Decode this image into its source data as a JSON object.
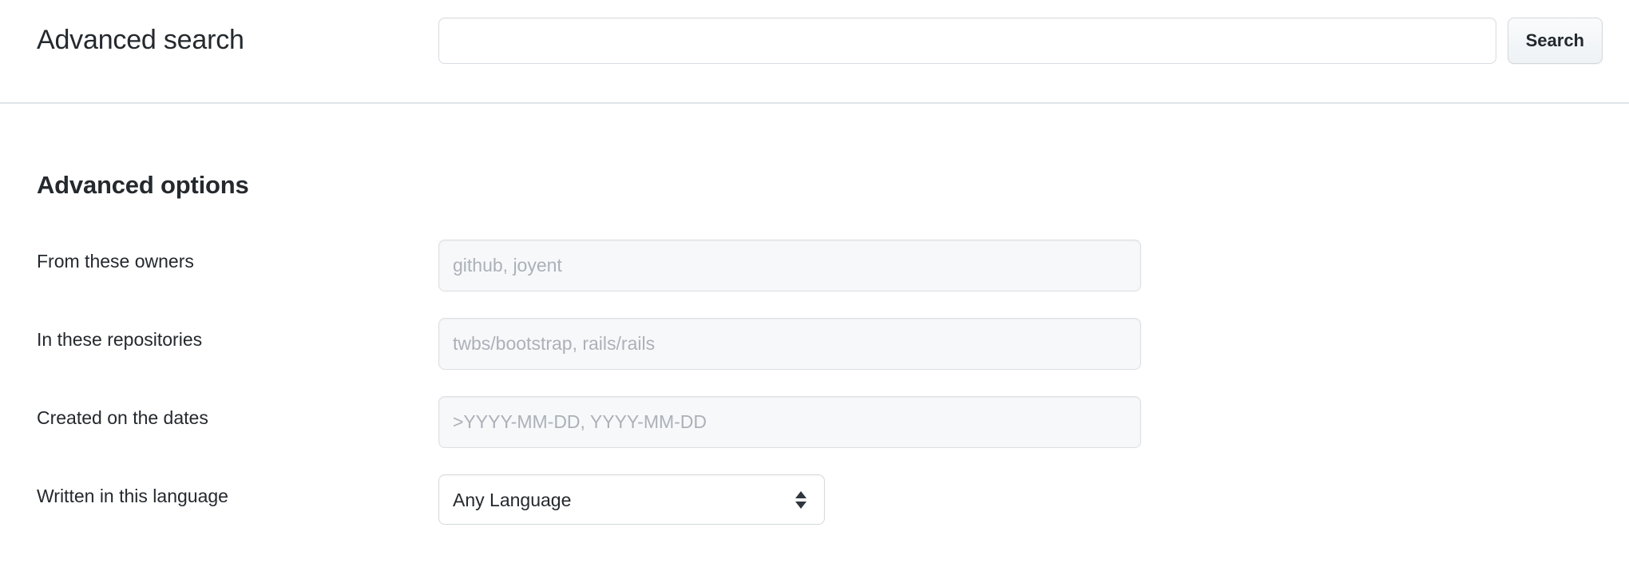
{
  "header": {
    "title": "Advanced search",
    "search_value": "",
    "search_placeholder": "",
    "search_button_label": "Search"
  },
  "options": {
    "heading": "Advanced options",
    "fields": [
      {
        "label": "From these owners",
        "type": "text",
        "value": "",
        "placeholder": "github, joyent"
      },
      {
        "label": "In these repositories",
        "type": "text",
        "value": "",
        "placeholder": "twbs/bootstrap, rails/rails"
      },
      {
        "label": "Created on the dates",
        "type": "text",
        "value": "",
        "placeholder": ">YYYY-MM-DD, YYYY-MM-DD"
      },
      {
        "label": "Written in this language",
        "type": "select",
        "value": "Any Language",
        "options": [
          "Any Language"
        ]
      }
    ]
  },
  "colors": {
    "text": "#24292e",
    "placeholder": "#acb1b8",
    "border": "#dcdfe3",
    "input_bg": "#f7f8fa",
    "divider": "#e1e4e8",
    "button_bg": "#eff3f6"
  }
}
